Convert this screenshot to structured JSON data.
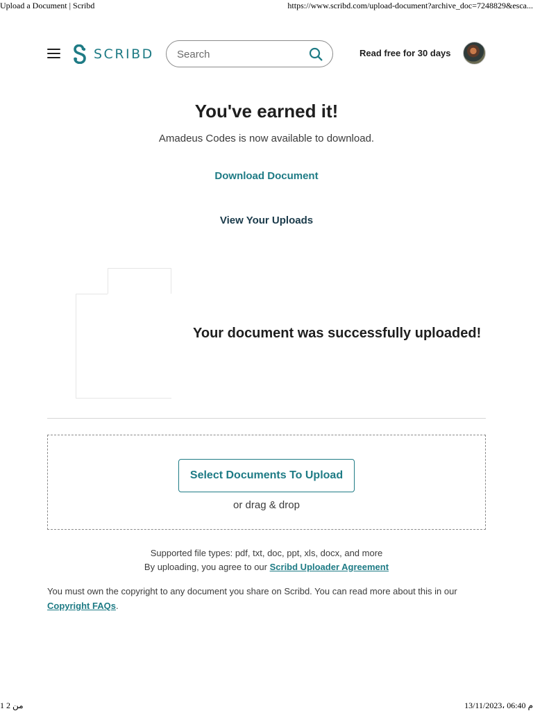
{
  "print_header": {
    "title": "Upload a Document | Scribd",
    "url": "https://www.scribd.com/upload-document?archive_doc=7248829&esca..."
  },
  "print_footer": {
    "page": "1 من 2",
    "datetime": "13/11/2023، 06:40 م"
  },
  "nav": {
    "menu_icon": "hamburger-icon",
    "logo_text": "SCRIBD",
    "search_placeholder": "Search",
    "search_icon": "search-icon",
    "read_free": "Read free for 30 days",
    "avatar": "user-avatar"
  },
  "success": {
    "title": "You've earned it!",
    "subtitle": "Amadeus Codes is now available to download.",
    "download_link": "Download Document",
    "uploads_link": "View Your Uploads",
    "upload_message": "Your document was successfully uploaded!"
  },
  "upload": {
    "select_button": "Select Documents To Upload",
    "drag_drop": "or drag & drop",
    "file_types": "Supported file types: pdf, txt, doc, ppt, xls, docx, and more",
    "agree_prefix": "By uploading, you agree to our ",
    "agree_link": "Scribd Uploader Agreement",
    "copyright_text": "You must own the copyright to any document you share on Scribd. You can read more about this in our ",
    "copyright_link": "Copyright FAQs",
    "copyright_suffix": "."
  },
  "colors": {
    "brand_teal": "#1e7b85",
    "dark_text": "#1e1e1e",
    "uploads_link": "#1a3a4a"
  }
}
